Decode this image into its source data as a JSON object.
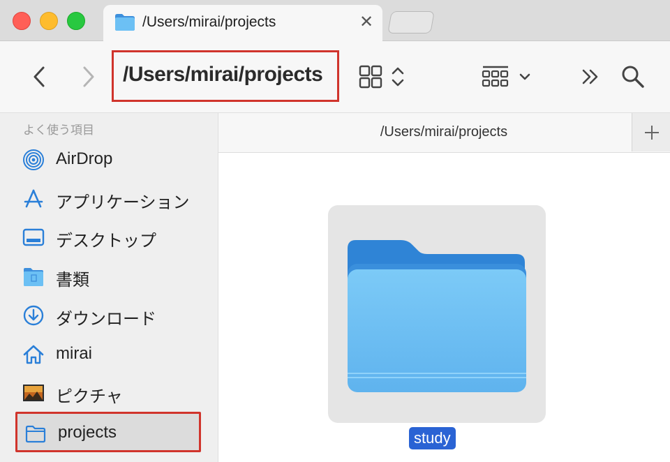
{
  "window": {
    "tab_title": "/Users/mirai/projects"
  },
  "toolbar": {
    "path": "/Users/mirai/projects"
  },
  "sidebar": {
    "heading": "よく使う項目",
    "items": [
      {
        "label": "AirDrop",
        "icon": "airdrop-icon"
      },
      {
        "label": "アプリケーション",
        "icon": "applications-icon"
      },
      {
        "label": "デスクトップ",
        "icon": "desktop-icon"
      },
      {
        "label": "書類",
        "icon": "documents-icon"
      },
      {
        "label": "ダウンロード",
        "icon": "downloads-icon"
      },
      {
        "label": "mirai",
        "icon": "home-icon"
      },
      {
        "label": "ピクチャ",
        "icon": "pictures-icon"
      },
      {
        "label": "projects",
        "icon": "folder-icon",
        "selected": true
      }
    ]
  },
  "content": {
    "pathbar_title": "/Users/mirai/projects",
    "items": [
      {
        "name": "study",
        "type": "folder",
        "selected": true
      }
    ]
  },
  "colors": {
    "highlight_red": "#d0342c",
    "selection_blue": "#2a63d4",
    "folder_blue": "#64b9f2"
  }
}
